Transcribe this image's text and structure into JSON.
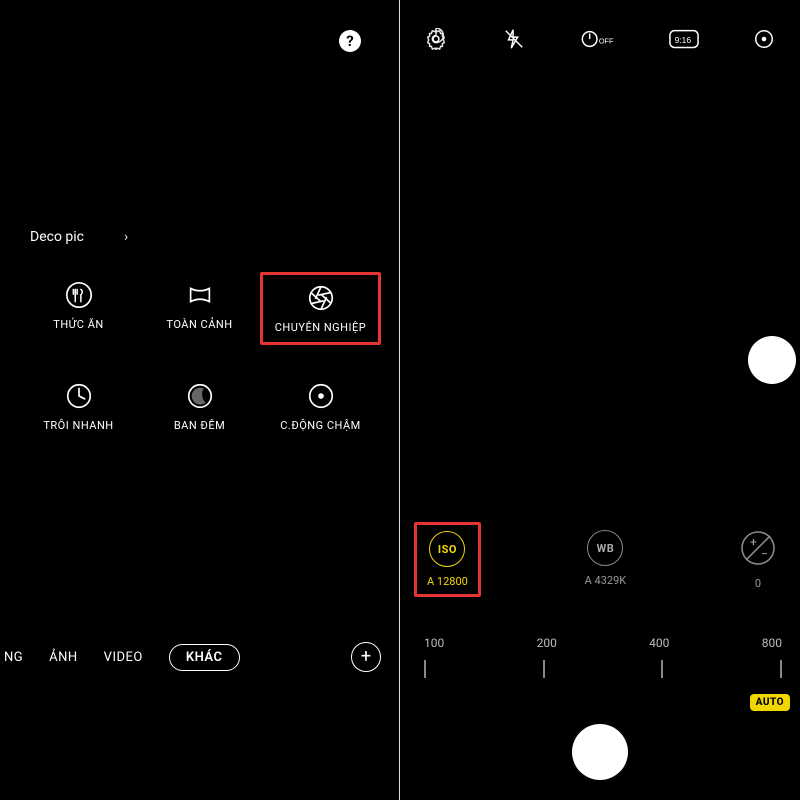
{
  "left": {
    "deco_label": "Deco pic",
    "modes": [
      {
        "label": "THỨC ĂN",
        "icon": "food"
      },
      {
        "label": "TOÀN CẢNH",
        "icon": "panorama"
      },
      {
        "label": "CHUYÊN NGHIỆP",
        "icon": "aperture",
        "highlight": true
      },
      {
        "label": "TRÔI NHANH",
        "icon": "timer"
      },
      {
        "label": "BAN ĐÊM",
        "icon": "moon"
      },
      {
        "label": "C.ĐỘNG CHẬM",
        "icon": "focus"
      }
    ],
    "tabs": {
      "t0": "NG",
      "t1": "ẢNH",
      "t2": "VIDEO",
      "t3": "KHÁC"
    }
  },
  "right": {
    "top": {
      "timer": "OFF",
      "ratio": "9:16"
    },
    "controls": {
      "iso": {
        "label": "ISO",
        "value": "A 12800"
      },
      "wb": {
        "label": "WB",
        "value": "A 4329K"
      },
      "ev": {
        "value": "0"
      }
    },
    "scale": {
      "s0": "100",
      "s1": "200",
      "s2": "400",
      "s3": "800",
      "auto": "AUTO"
    }
  }
}
